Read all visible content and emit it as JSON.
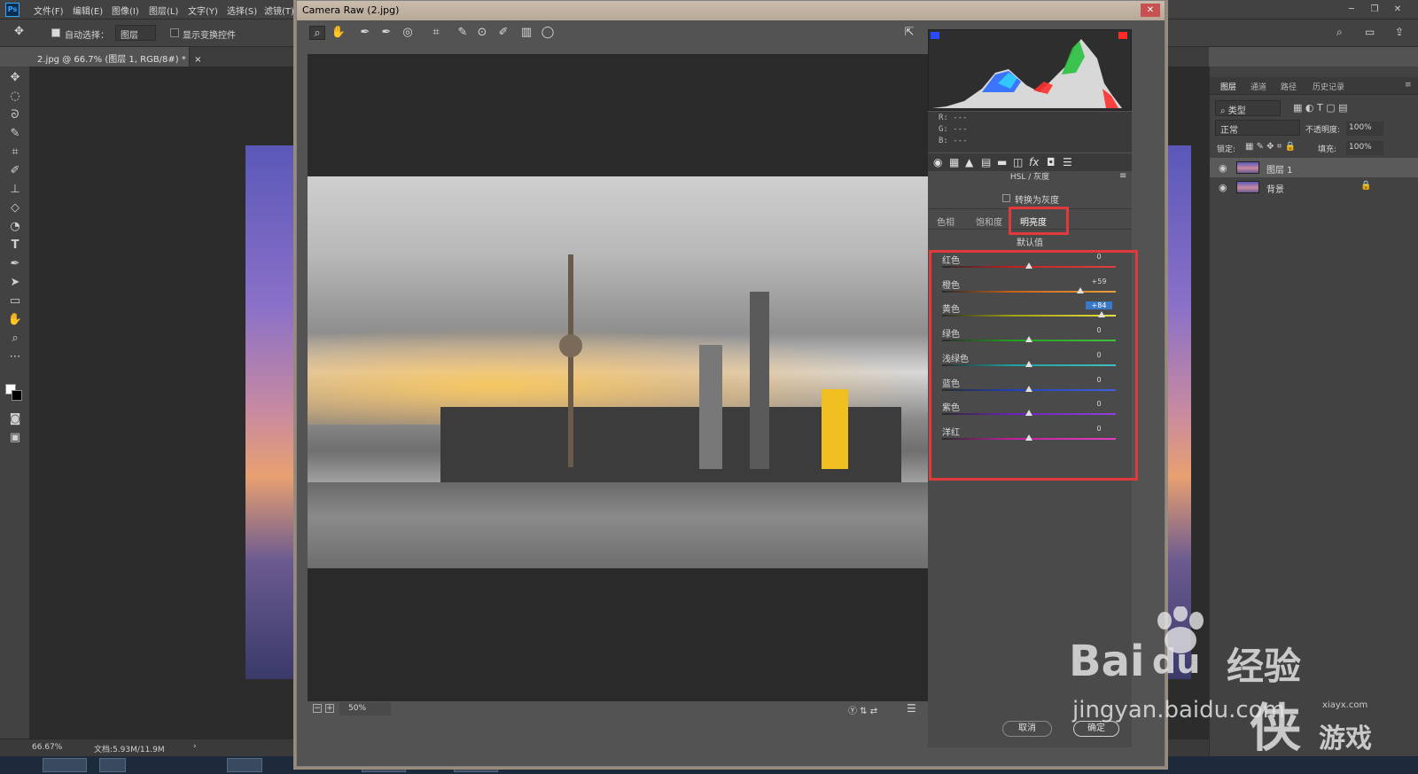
{
  "ps": {
    "menu": [
      "文件(F)",
      "编辑(E)",
      "图像(I)",
      "图层(L)",
      "文字(Y)",
      "选择(S)",
      "滤镜(T)"
    ],
    "options": {
      "auto_select_label": "自动选择：",
      "auto_select_value": "图层",
      "show_transform_label": "显示变换控件"
    },
    "doc_tab": "2.jpg @ 66.7% (图层 1, RGB/8#) *",
    "status": {
      "zoom": "66.67%",
      "doc_info": "文档:5.93M/11.9M"
    }
  },
  "layers_panel": {
    "tabs": [
      "图层",
      "通道",
      "路径",
      "历史记录"
    ],
    "filter_label": "类型",
    "blend_mode": "正常",
    "opacity_label": "不透明度:",
    "opacity_value": "100%",
    "lock_label": "锁定:",
    "fill_label": "填充:",
    "fill_value": "100%",
    "layers": [
      {
        "name": "图层 1",
        "selected": true
      },
      {
        "name": "背景",
        "selected": false
      }
    ]
  },
  "acr": {
    "title": "Camera Raw (2.jpg)",
    "rgb": {
      "r": "R:  ---",
      "g": "G:  ---",
      "b": "B:  ---"
    },
    "section_title": "HSL / 灰度",
    "convert_gray_label": "转换为灰度",
    "tabs": [
      "色相",
      "饱和度",
      "明亮度"
    ],
    "active_tab": "明亮度",
    "default_label": "默认值",
    "sliders": [
      {
        "label": "红色",
        "value": "0",
        "fraction": 0.5,
        "color_from": "#c02020",
        "color_to": "#e04040"
      },
      {
        "label": "橙色",
        "value": "+59",
        "fraction": 0.795,
        "color_from": "#c86018",
        "color_to": "#e8a040"
      },
      {
        "label": "黄色",
        "value": "+84",
        "fraction": 0.92,
        "color_from": "#a0a010",
        "color_to": "#e8e040",
        "highlight": true
      },
      {
        "label": "绿色",
        "value": "0",
        "fraction": 0.5,
        "color_from": "#20a020",
        "color_to": "#40c040"
      },
      {
        "label": "浅绿色",
        "value": "0",
        "fraction": 0.5,
        "color_from": "#20a0a0",
        "color_to": "#40c0c0"
      },
      {
        "label": "蓝色",
        "value": "0",
        "fraction": 0.5,
        "color_from": "#2040c0",
        "color_to": "#4060e0"
      },
      {
        "label": "紫色",
        "value": "0",
        "fraction": 0.5,
        "color_from": "#7020c0",
        "color_to": "#9040e0"
      },
      {
        "label": "洋红",
        "value": "0",
        "fraction": 0.5,
        "color_from": "#c020a0",
        "color_to": "#e040c0"
      }
    ],
    "zoom": "50%",
    "cancel_label": "取消",
    "ok_label": "确定"
  },
  "watermark": {
    "baidu": "Bai",
    "baidu_du": "du",
    "jingyan": "经验",
    "url": "jingyan.baidu.com",
    "site": "xiayx.com",
    "game": "游戏"
  },
  "colors": {
    "highlight_box": "#e03a3a",
    "accent_blue": "#3a78c8"
  }
}
